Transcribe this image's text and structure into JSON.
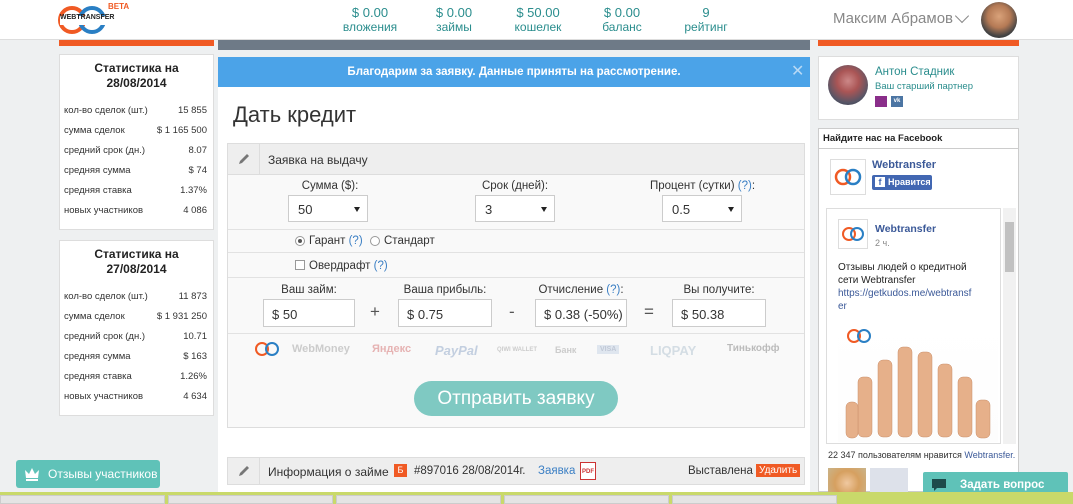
{
  "header": {
    "logo_text": "WEBTRANSFER",
    "logo_badge": "BETA",
    "stats": [
      {
        "value": "$ 0.00",
        "label": "вложения"
      },
      {
        "value": "$ 0.00",
        "label": "займы"
      },
      {
        "value": "$ 50.00",
        "label": "кошелек"
      },
      {
        "value": "$ 0.00",
        "label": "баланс"
      },
      {
        "value": "9",
        "label": "рейтинг"
      }
    ],
    "user_name": "Максим Абрамов"
  },
  "colors": {
    "accent": "#f05a24",
    "teal": "#5fc2b8",
    "notice": "#4ba3e8"
  },
  "stats_blocks": [
    {
      "title_line1": "Статистика на",
      "title_line2": "28/08/2014",
      "rows": [
        {
          "label": "кол-во сделок (шт.)",
          "value": "15 855"
        },
        {
          "label": "сумма сделок",
          "value": "$ 1 165 500"
        },
        {
          "label": "средний срок (дн.)",
          "value": "8.07"
        },
        {
          "label": "средняя сумма",
          "value": "$ 74"
        },
        {
          "label": "средняя ставка",
          "value": "1.37%"
        },
        {
          "label": "новых участников",
          "value": "4 086"
        }
      ]
    },
    {
      "title_line1": "Статистика на",
      "title_line2": "27/08/2014",
      "rows": [
        {
          "label": "кол-во сделок (шт.)",
          "value": "11 873"
        },
        {
          "label": "сумма сделок",
          "value": "$ 1 931 250"
        },
        {
          "label": "средний срок (дн.)",
          "value": "10.71"
        },
        {
          "label": "средняя сумма",
          "value": "$ 163"
        },
        {
          "label": "средняя ставка",
          "value": "1.26%"
        },
        {
          "label": "новых участников",
          "value": "4 634"
        }
      ]
    }
  ],
  "reviews_button": "Отзывы участников",
  "notice": {
    "text": "Благодарим за заявку. Данные приняты на рассмотрение.",
    "close": "✕"
  },
  "page_title": "Дать кредит",
  "form": {
    "header": "Заявка на выдачу",
    "amount_label": "Сумма ($):",
    "amount_value": "50",
    "term_label": "Срок (дней):",
    "term_value": "3",
    "rate_label": "Процент (сутки)",
    "rate_q": "(?)",
    "rate_colon": ":",
    "rate_value": "0.5",
    "guarant_label": "Гарант",
    "guarant_q": "(?)",
    "standard_label": "Стандарт",
    "overdraft_label": "Овердрафт",
    "overdraft_q": "(?)",
    "loan_label": "Ваш займ:",
    "loan_value": "$ 50",
    "profit_label": "Ваша прибыль:",
    "profit_value": "$ 0.75",
    "deduct_label": "Отчисление",
    "deduct_q": "(?)",
    "deduct_colon": ":",
    "deduct_value": "$ 0.38 (-50%)",
    "receive_label": "Вы получите:",
    "receive_value": "$ 50.38",
    "op_plus": "+",
    "op_minus": "-",
    "op_eq": "=",
    "payments": [
      "WebMoney",
      "Яндекс",
      "PayPal",
      "QIWI WALLET",
      "Банк",
      "VISA",
      "LIQPAY",
      "Тинькофф"
    ],
    "submit": "Отправить заявку"
  },
  "info": {
    "header": "Информация о займе",
    "badge": "Б",
    "number": "#897016 28/08/2014г.",
    "link": "Заявка",
    "status": "Выставлена",
    "delete": "Удалить"
  },
  "partner": {
    "name": "Антон Стадник",
    "role": "Ваш старший партнер"
  },
  "facebook": {
    "title": "Найдите нас на Facebook",
    "page_name": "Webtransfer",
    "like": "Нравится",
    "post_page": "Webtransfer",
    "post_time": "2 ч.",
    "post_text1": "Отзывы людей о кредитной",
    "post_text2": "сети Webtransfer",
    "post_link1": "https://getkudos.me/webtransf",
    "post_link2": "er",
    "likes_count": "22 347 пользователям нравится",
    "likes_page": "Webtransfer."
  },
  "chat": "Задать вопрос"
}
